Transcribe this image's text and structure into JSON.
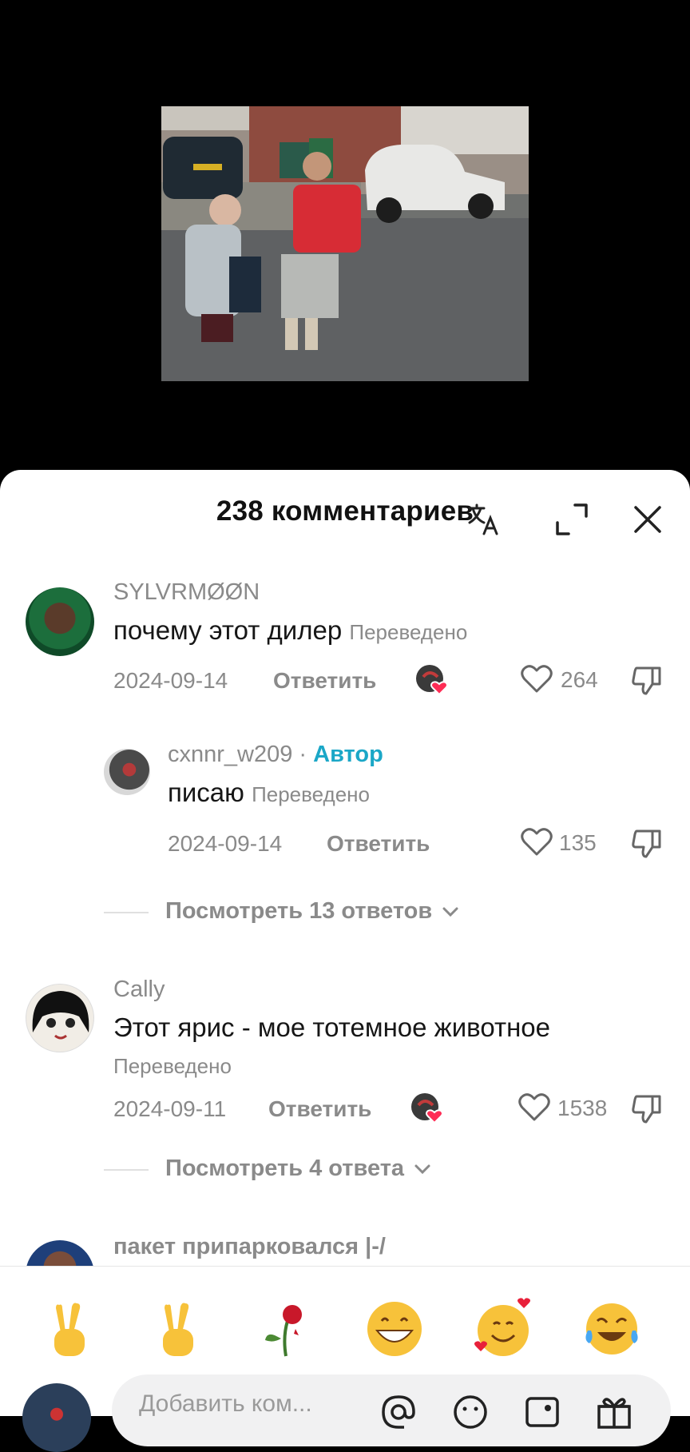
{
  "header": {
    "title": "238 комментариев"
  },
  "comments": [
    {
      "username": "SYLVRMØØN",
      "text": "почему этот дилер",
      "translated": "Переведено",
      "date": "2024-09-14",
      "reply": "Ответить",
      "likes": "264"
    },
    {
      "username": "cxnnr_w209",
      "author_sep": " · ",
      "author_badge": "Автор",
      "text": "писаю",
      "translated": "Переведено",
      "date": "2024-09-14",
      "reply": "Ответить",
      "likes": "135"
    },
    {
      "username": "Cally",
      "text": "Этот ярис - мое тотемное животное",
      "translated": "Переведено",
      "date": "2024-09-11",
      "reply": "Ответить",
      "likes": "1538"
    },
    {
      "username": "пакет припарковался |-/"
    }
  ],
  "view_replies": [
    {
      "label": "Посмотреть 13 ответов"
    },
    {
      "label": "Посмотреть 4 ответа"
    }
  ],
  "composer": {
    "placeholder": "Добавить ком..."
  },
  "emoji_bar": [
    "victory-hand",
    "victory-hand",
    "wilted-rose",
    "grinning-face",
    "smiling-face-with-hearts",
    "tears-of-joy"
  ],
  "colors": {
    "author_badge": "#1ba7c7",
    "like_heart": "#fe2c55",
    "muted_text": "#8a8a8a"
  }
}
